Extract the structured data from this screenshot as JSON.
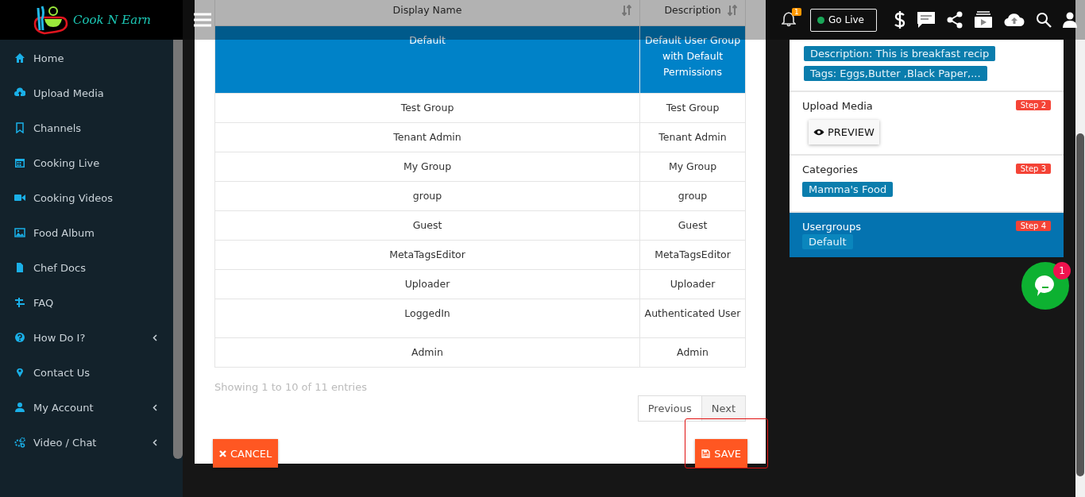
{
  "brand": {
    "name": "Cook N Earn"
  },
  "sidebar": {
    "items": [
      {
        "label": "Home",
        "submenu": false
      },
      {
        "label": "Upload Media",
        "submenu": false
      },
      {
        "label": "Channels",
        "submenu": false
      },
      {
        "label": "Cooking Live",
        "submenu": false
      },
      {
        "label": "Cooking Videos",
        "submenu": false
      },
      {
        "label": "Food Album",
        "submenu": false
      },
      {
        "label": "Chef Docs",
        "submenu": false
      },
      {
        "label": "FAQ",
        "submenu": false
      },
      {
        "label": "How Do I?",
        "submenu": true
      },
      {
        "label": "Contact Us",
        "submenu": false
      },
      {
        "label": "My Account",
        "submenu": true
      },
      {
        "label": "Video / Chat",
        "submenu": true
      }
    ]
  },
  "topbar": {
    "notification_count": "1",
    "go_live": "Go Live"
  },
  "table": {
    "columns": [
      {
        "label": "Display Name"
      },
      {
        "label": "Description"
      }
    ],
    "rows": [
      {
        "cells": [
          "Default",
          "Default User Group with Default Permissions"
        ],
        "selected": true
      },
      {
        "cells": [
          "Test Group",
          "Test Group"
        ],
        "selected": false
      },
      {
        "cells": [
          "Tenant Admin",
          "Tenant Admin"
        ],
        "selected": false
      },
      {
        "cells": [
          "My Group",
          "My Group"
        ],
        "selected": false
      },
      {
        "cells": [
          "group",
          "group"
        ],
        "selected": false
      },
      {
        "cells": [
          "Guest",
          "Guest"
        ],
        "selected": false
      },
      {
        "cells": [
          "MetaTagsEditor",
          "MetaTagsEditor"
        ],
        "selected": false
      },
      {
        "cells": [
          "Uploader",
          "Uploader"
        ],
        "selected": false
      },
      {
        "cells": [
          "LoggedIn",
          "Authenticated User"
        ],
        "selected": false
      },
      {
        "cells": [
          "Admin",
          "Admin"
        ],
        "selected": false
      }
    ],
    "info": "Showing 1 to 10 of 11 entries",
    "pagination": [
      "Previous",
      "Next"
    ]
  },
  "dialog_buttons": {
    "cancel": "CANCEL",
    "save": "SAVE"
  },
  "summary": {
    "chips": [
      "Description: This is breakfast recip",
      "Tags: Eggs,Butter ,Black Paper,..."
    ],
    "steps": [
      {
        "title": "Upload Media",
        "step": "Step 2",
        "active": false,
        "kind": "button",
        "content": "PREVIEW"
      },
      {
        "title": "Categories",
        "step": "Step 3",
        "active": false,
        "kind": "chip",
        "content": "Mamma's Food"
      },
      {
        "title": "Usergroups",
        "step": "Step 4",
        "active": true,
        "kind": "chip",
        "content": "Default"
      }
    ]
  },
  "chat": {
    "badge": "1"
  }
}
